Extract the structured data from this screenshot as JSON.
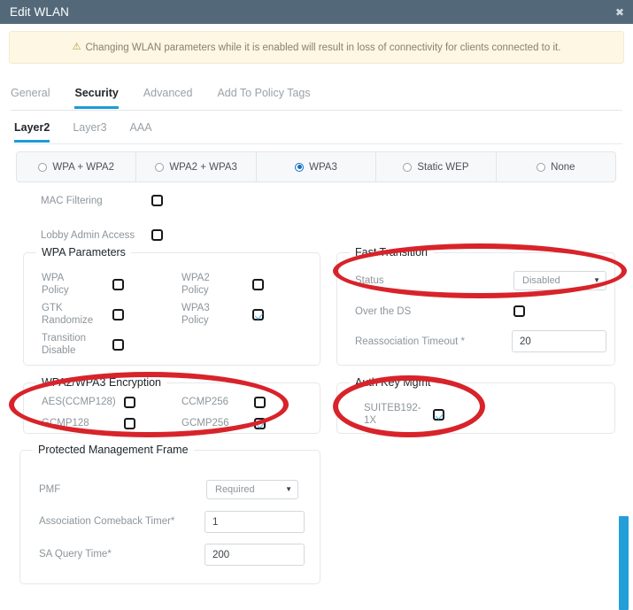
{
  "window": {
    "title": "Edit WLAN",
    "close_icon": "close-icon",
    "close_glyph": "✖"
  },
  "warning": {
    "icon": "warning-triangle-icon",
    "glyph": "⚠",
    "text": "Changing WLAN parameters while it is enabled will result in loss of connectivity for clients connected to it."
  },
  "top_tabs": [
    {
      "label": "General",
      "active": false
    },
    {
      "label": "Security",
      "active": true
    },
    {
      "label": "Advanced",
      "active": false
    },
    {
      "label": "Add To Policy Tags",
      "active": false
    }
  ],
  "sub_tabs": [
    {
      "label": "Layer2",
      "active": true
    },
    {
      "label": "Layer3",
      "active": false
    },
    {
      "label": "AAA",
      "active": false
    }
  ],
  "security_modes": [
    {
      "label": "WPA + WPA2",
      "selected": false
    },
    {
      "label": "WPA2 + WPA3",
      "selected": false
    },
    {
      "label": "WPA3",
      "selected": true
    },
    {
      "label": "Static WEP",
      "selected": false
    },
    {
      "label": "None",
      "selected": false
    }
  ],
  "top_options": [
    {
      "label": "MAC Filtering",
      "checked": false
    },
    {
      "label": "Lobby Admin Access",
      "checked": false
    }
  ],
  "wpa_parameters": {
    "legend": "WPA Parameters",
    "left": [
      {
        "label": "WPA Policy",
        "line1": "WPA",
        "line2": "Policy",
        "checked": false
      },
      {
        "label": "GTK Randomize",
        "line1": "GTK",
        "line2": "Randomize",
        "checked": false
      },
      {
        "label": "Transition Disable",
        "line1": "Transition",
        "line2": "Disable",
        "checked": false
      }
    ],
    "right": [
      {
        "label": "WPA2 Policy",
        "line1": "WPA2",
        "line2": "Policy",
        "checked": false
      },
      {
        "label": "WPA3 Policy",
        "line1": "WPA3",
        "line2": "Policy",
        "checked": true
      }
    ]
  },
  "fast_transition": {
    "legend": "Fast Transition",
    "status_label": "Status",
    "status_value": "Disabled",
    "over_the_ds_label": "Over the DS",
    "over_the_ds_checked": false,
    "reassoc_label": "Reassociation Timeout *",
    "reassoc_value": "20"
  },
  "encryption": {
    "legend": "WPA2/WPA3 Encryption",
    "items": [
      {
        "label": "AES(CCMP128)",
        "checked": false
      },
      {
        "label": "CCMP256",
        "checked": false
      },
      {
        "label": "GCMP128",
        "checked": false
      },
      {
        "label": "GCMP256",
        "checked": true
      }
    ]
  },
  "auth_key_mgmt": {
    "legend": "Auth Key Mgmt",
    "items": [
      {
        "line1": "SUITEB192-",
        "line2": "1X",
        "checked": true
      }
    ]
  },
  "pmf": {
    "legend": "Protected Management Frame",
    "pmf_label": "PMF",
    "pmf_value": "Required",
    "acb_label": "Association Comeback Timer*",
    "acb_value": "1",
    "sa_label": "SA Query Time*",
    "sa_value": "200"
  },
  "colors": {
    "titlebar": "#53697a",
    "accent": "#1d9bd6",
    "annotation": "#d8232a",
    "warning_bg": "#fdf7e3",
    "scrollbar": "#229ed9"
  }
}
